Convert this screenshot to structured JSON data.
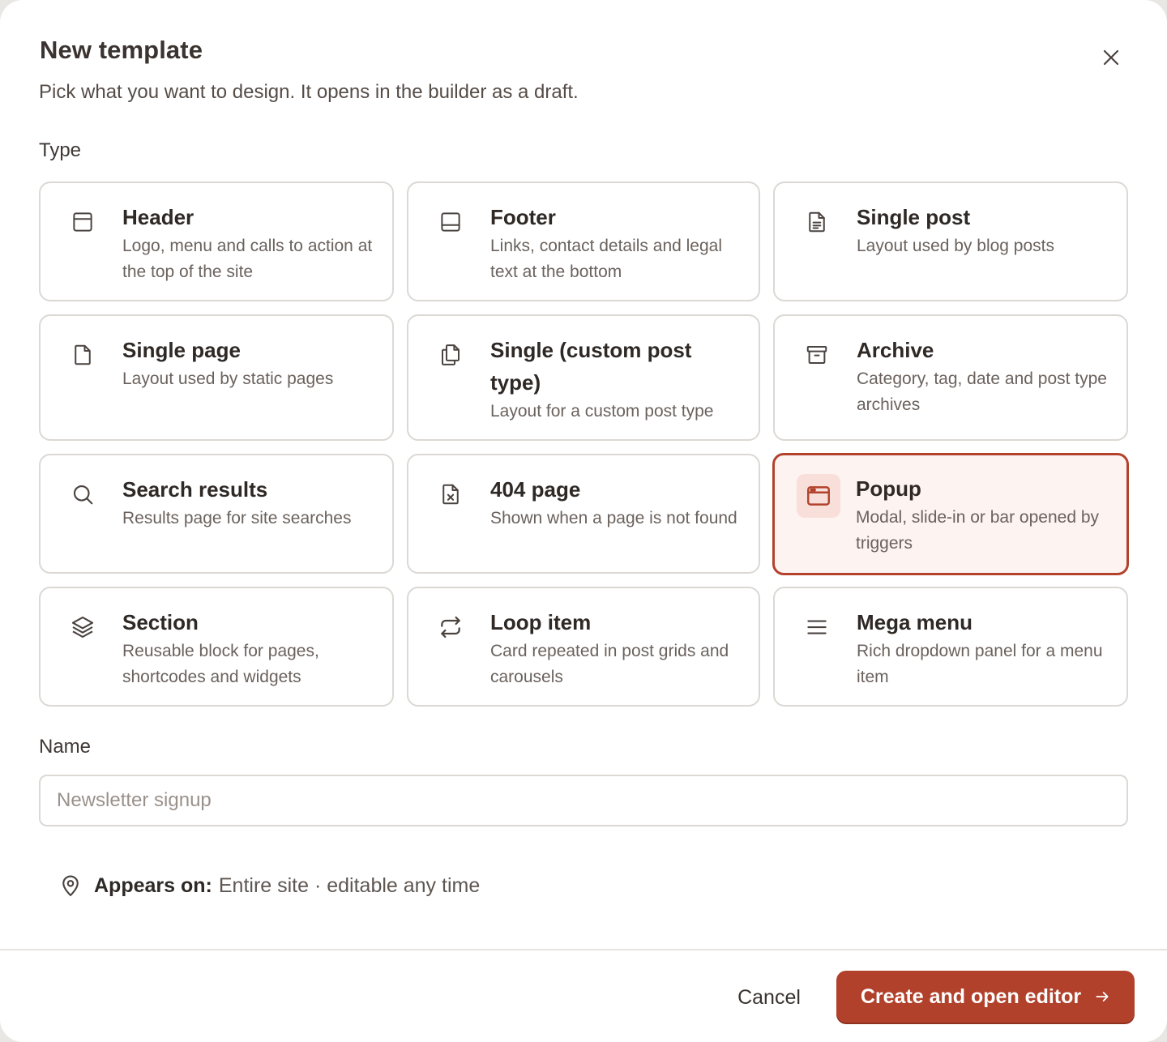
{
  "dialog": {
    "title": "New template",
    "subtitle": "Pick what you want to design. It opens in the builder as a draft.",
    "close_icon": "close-icon"
  },
  "type_label": "Type",
  "types": [
    {
      "id": "header",
      "title": "Header",
      "description": "Logo, menu and calls to action at the top of the site",
      "icon": "header-layout-icon",
      "selected": false
    },
    {
      "id": "footer",
      "title": "Footer",
      "description": "Links, contact details and legal text at the bottom",
      "icon": "footer-layout-icon",
      "selected": false
    },
    {
      "id": "single-post",
      "title": "Single post",
      "description": "Layout used by blog posts",
      "icon": "document-text-icon",
      "selected": false
    },
    {
      "id": "single-page",
      "title": "Single page",
      "description": "Layout used by static pages",
      "icon": "page-icon",
      "selected": false
    },
    {
      "id": "single-custom",
      "title": "Single (custom post type)",
      "description": "Layout for a custom post type",
      "icon": "copy-pages-icon",
      "selected": false
    },
    {
      "id": "archive",
      "title": "Archive",
      "description": "Category, tag, date and post type archives",
      "icon": "archive-box-icon",
      "selected": false
    },
    {
      "id": "search-results",
      "title": "Search results",
      "description": "Results page for site searches",
      "icon": "search-icon",
      "selected": false
    },
    {
      "id": "404-page",
      "title": "404 page",
      "description": "Shown when a page is not found",
      "icon": "file-x-icon",
      "selected": false
    },
    {
      "id": "popup",
      "title": "Popup",
      "description": "Modal, slide-in or bar opened by triggers",
      "icon": "browser-window-icon",
      "selected": true
    },
    {
      "id": "section",
      "title": "Section",
      "description": "Reusable block for pages, shortcodes and widgets",
      "icon": "layers-icon",
      "selected": false
    },
    {
      "id": "loop-item",
      "title": "Loop item",
      "description": "Card repeated in post grids and carousels",
      "icon": "repeat-arrows-icon",
      "selected": false
    },
    {
      "id": "mega-menu",
      "title": "Mega menu",
      "description": "Rich dropdown panel for a menu item",
      "icon": "menu-lines-icon",
      "selected": false
    }
  ],
  "name_label": "Name",
  "name_input": {
    "value": "",
    "placeholder": "Newsletter signup"
  },
  "appears_on": {
    "label": "Appears on:",
    "value": "Entire site · editable any time",
    "icon": "map-pin-icon"
  },
  "footer": {
    "cancel_label": "Cancel",
    "primary_label": "Create and open editor",
    "primary_icon": "arrow-right-icon"
  },
  "colors": {
    "accent": "#b1412b",
    "selected_bg": "#fdf3f1",
    "border": "#dcd8d4",
    "text": "#2f2926",
    "muted": "#6b625d"
  }
}
